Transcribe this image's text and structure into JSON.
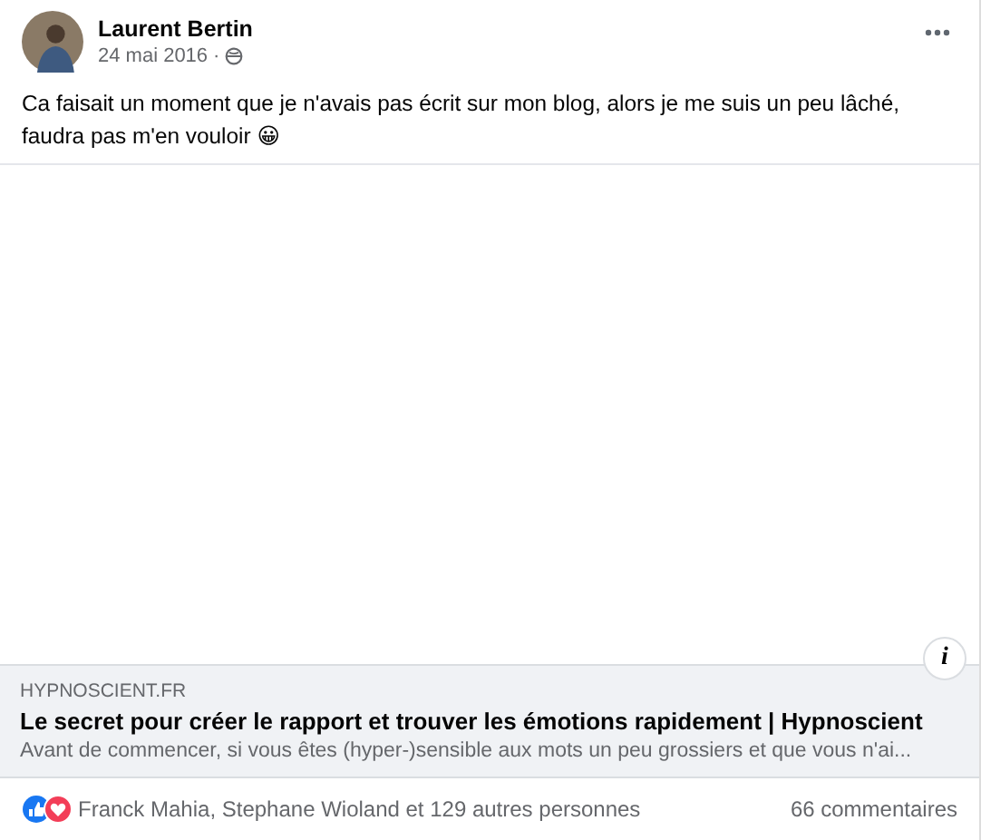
{
  "post": {
    "author": "Laurent Bertin",
    "date": "24 mai 2016",
    "separator": "·",
    "text": "Ca faisait un moment que je n'avais pas écrit sur mon blog, alors je me suis un peu lâché, faudra pas m'en vouloir 😀"
  },
  "link_preview": {
    "kind": "picture-blank",
    "info": "i",
    "domain": "HYPNOSCIENT.FR",
    "title": "Le secret pour créer le rapport et trouver les émotions rapidement | Hypnoscient",
    "description": "Avant de commencer, si vous êtes (hyper-)sensible aux mots un peu grossiers et que vous n'ai..."
  },
  "reactions": {
    "names": "Franck Mahia, Stephane Wioland et 129 autres personnes",
    "comments": "66 commentaires"
  }
}
